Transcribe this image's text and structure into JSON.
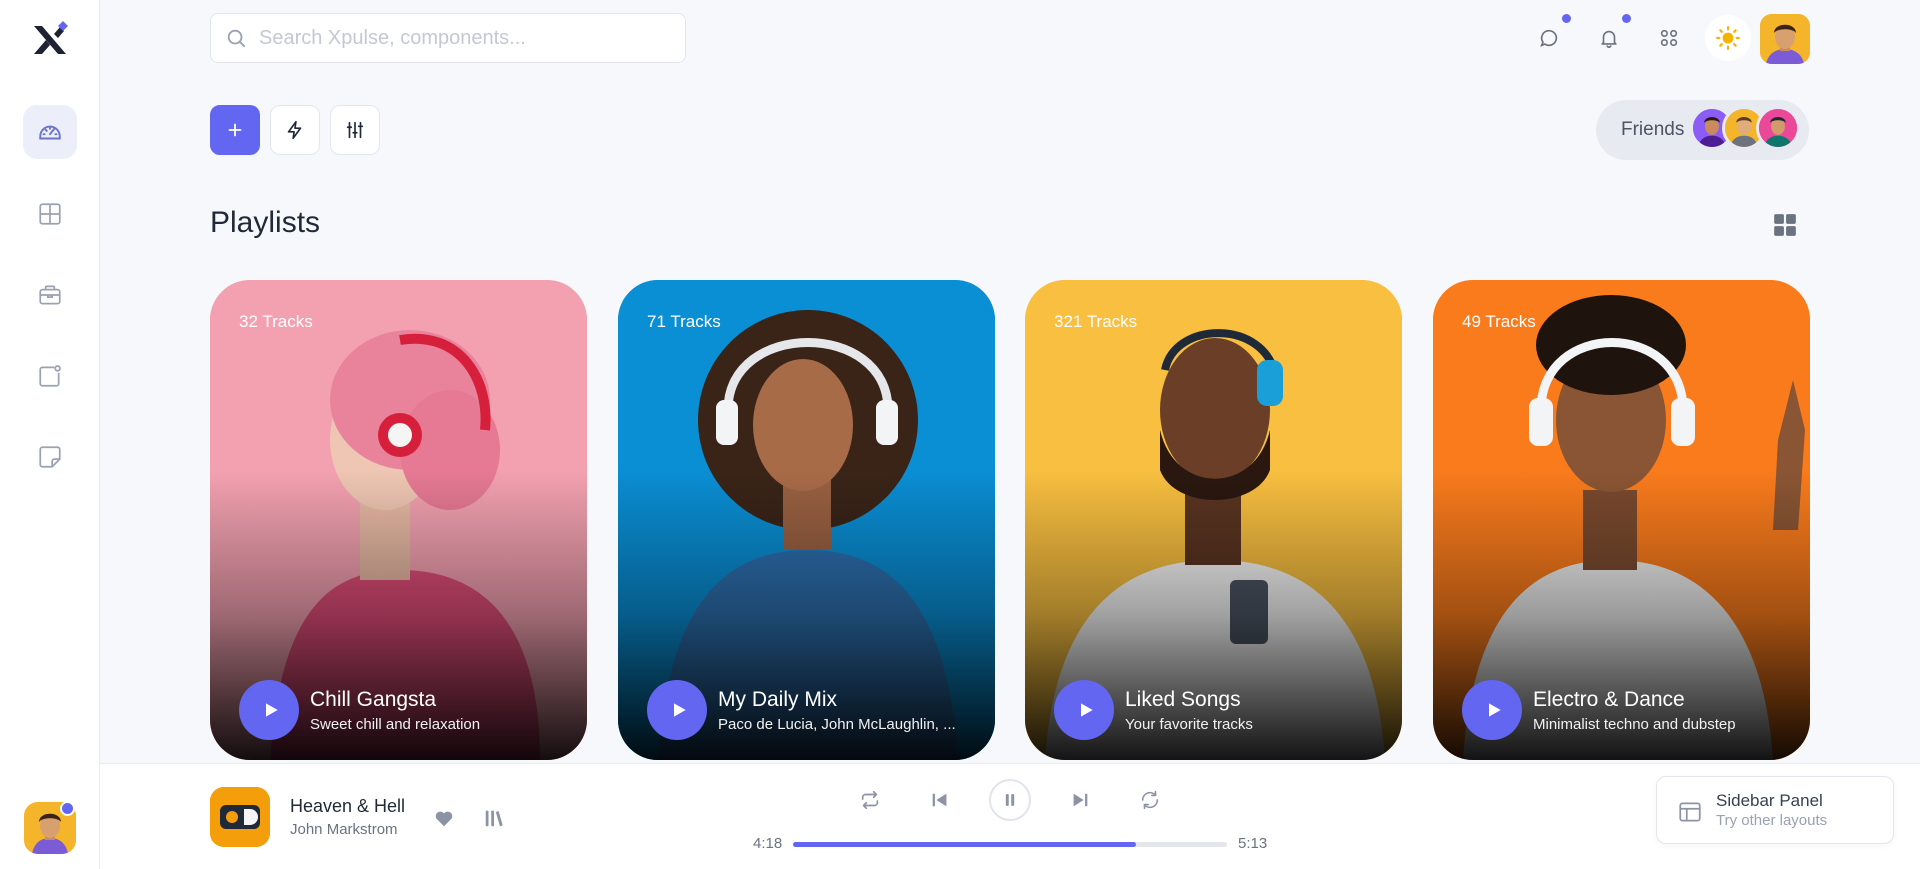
{
  "search": {
    "placeholder": "Search Xpulse, components..."
  },
  "icons": {
    "logo": "xpulse-logo-icon",
    "sidebar": [
      "dashboard-gauge-icon",
      "layout-grid-icon",
      "briefcase-icon",
      "window-badge-icon",
      "sticky-note-icon"
    ],
    "header": [
      "chat-icon",
      "bell-icon",
      "apps-grid-icon",
      "sun-icon"
    ]
  },
  "colors": {
    "accent": "#6366f1",
    "card_pink": "#f3a1b0",
    "card_blue": "#0a8ed4",
    "card_yellow": "#f8bf40",
    "card_orange": "#fa7b1c"
  },
  "friends": {
    "label": "Friends"
  },
  "section": {
    "title": "Playlists"
  },
  "playlists": [
    {
      "tracks": "32 Tracks",
      "title": "Chill Gangsta",
      "subtitle": "Sweet chill and relaxation"
    },
    {
      "tracks": "71 Tracks",
      "title": "My Daily Mix",
      "subtitle": "Paco de Lucia, John McLaughlin, ..."
    },
    {
      "tracks": "321 Tracks",
      "title": "Liked Songs",
      "subtitle": "Your favorite tracks"
    },
    {
      "tracks": "49 Tracks",
      "title": "Electro & Dance",
      "subtitle": "Minimalist techno and dubstep"
    }
  ],
  "player": {
    "song": "Heaven & Hell",
    "artist": "John Markstrom",
    "elapsed": "4:18",
    "total": "5:13",
    "progress": 0.79
  },
  "layout_panel": {
    "title": "Sidebar Panel",
    "subtitle": "Try other layouts"
  }
}
